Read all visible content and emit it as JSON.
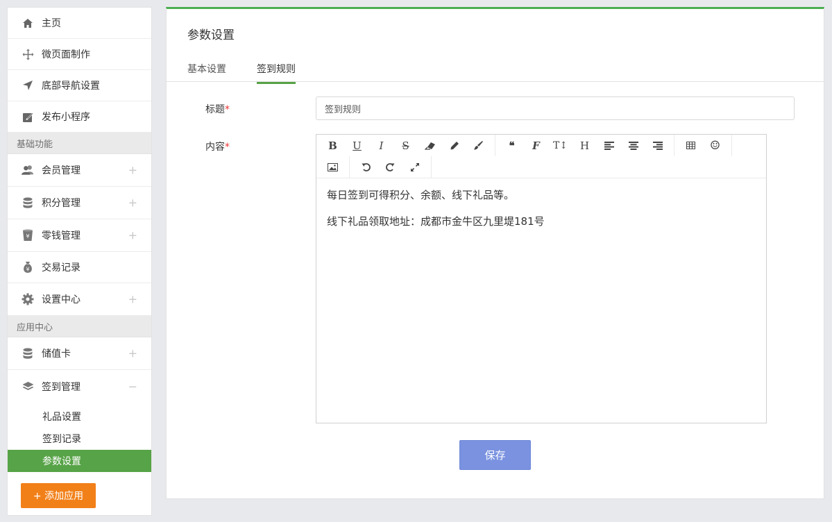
{
  "sidebar": {
    "top_items": [
      {
        "label": "主页",
        "icon": "home-icon"
      },
      {
        "label": "微页面制作",
        "icon": "move-icon"
      },
      {
        "label": "底部导航设置",
        "icon": "navigation-arrow-icon"
      },
      {
        "label": "发布小程序",
        "icon": "edit-square-icon"
      }
    ],
    "section_basic": "基础功能",
    "basic_items": [
      {
        "label": "会员管理",
        "icon": "users-icon",
        "expander": "+"
      },
      {
        "label": "积分管理",
        "icon": "database-icon",
        "expander": "+"
      },
      {
        "label": "零钱管理",
        "icon": "yen-cup-icon",
        "expander": "+"
      },
      {
        "label": "交易记录",
        "icon": "money-bag-icon",
        "expander": ""
      },
      {
        "label": "设置中心",
        "icon": "gear-icon",
        "expander": "+"
      }
    ],
    "section_apps": "应用中心",
    "app_items": [
      {
        "label": "储值卡",
        "icon": "database-icon",
        "expander": "+"
      },
      {
        "label": "签到管理",
        "icon": "layers-icon",
        "expander": "−"
      }
    ],
    "sub_items": [
      {
        "label": "礼品设置",
        "active": false
      },
      {
        "label": "签到记录",
        "active": false
      },
      {
        "label": "参数设置",
        "active": true
      }
    ],
    "add_app_label": "+ 添加应用"
  },
  "main": {
    "title": "参数设置",
    "tabs": [
      {
        "label": "基本设置",
        "active": false
      },
      {
        "label": "签到规则",
        "active": true
      }
    ],
    "form": {
      "title_label": "标题",
      "title_value": "签到规则",
      "content_label": "内容",
      "required_mark": "*",
      "content_lines": [
        "每日签到可得积分、余额、线下礼品等。",
        "线下礼品领取地址：成都市金牛区九里堤181号"
      ]
    },
    "toolbar": {
      "bold": "B",
      "underline": "U",
      "italic": "I",
      "strike": "S",
      "eraser": "eraser-icon",
      "pencil": "pencil-icon",
      "brush": "brush-icon",
      "quote": "❝",
      "font": "F",
      "fontsize": "T↕",
      "heading": "H",
      "align_left": "align-left-icon",
      "align_center": "align-center-icon",
      "align_right": "align-right-icon",
      "table": "table-icon",
      "emoji": "☺",
      "image": "image-icon",
      "undo": "undo-icon",
      "redo": "redo-icon",
      "fullscreen": "fullscreen-icon"
    },
    "save_label": "保存"
  },
  "colors": {
    "accent_green": "#57a347",
    "orange": "#f28019",
    "save_blue": "#7a92e0"
  }
}
